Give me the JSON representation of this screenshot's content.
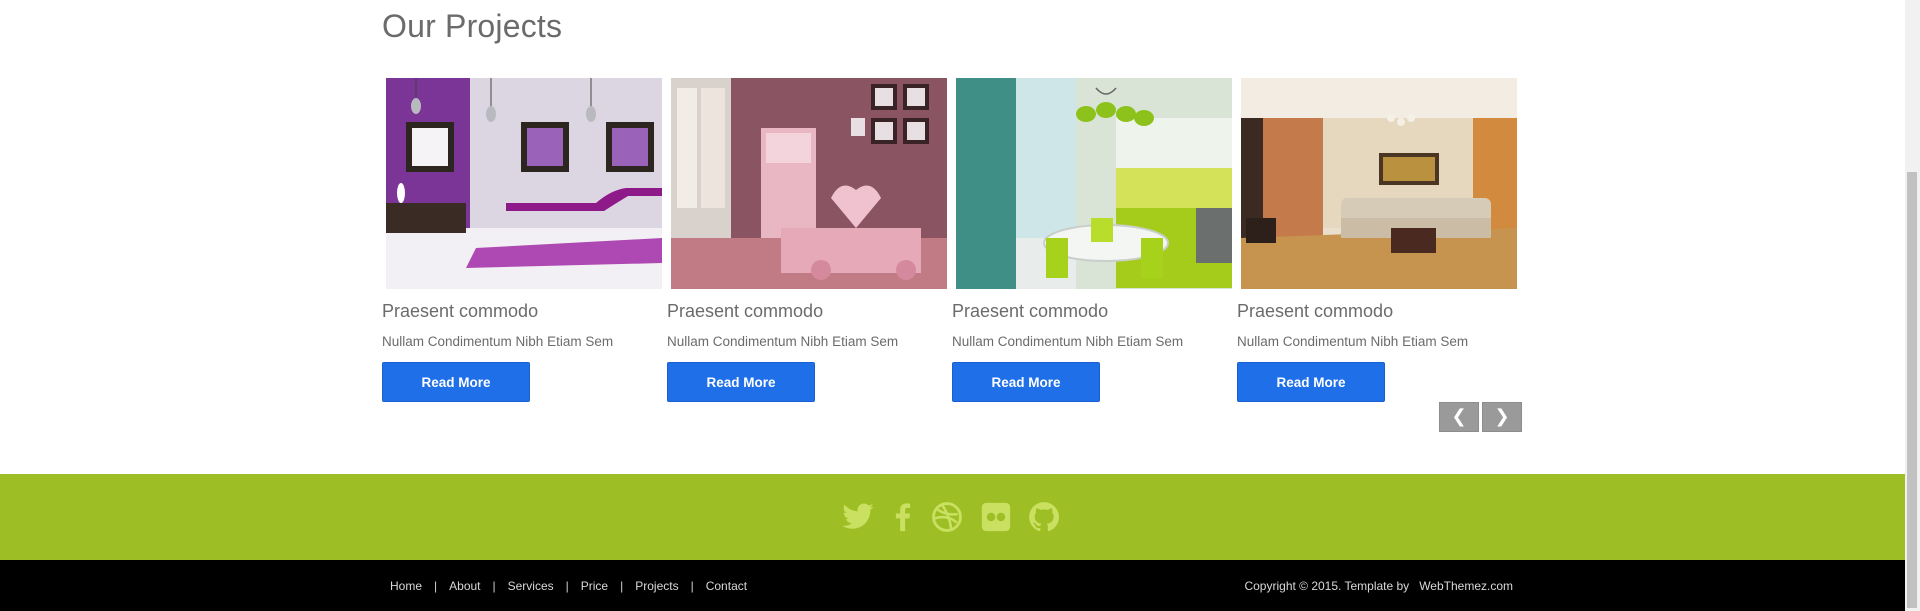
{
  "projects": {
    "title": "Our Projects",
    "items": [
      {
        "title": "Praesent commodo",
        "subtitle": "Nullam Condimentum Nibh Etiam Sem",
        "button": "Read More"
      },
      {
        "title": "Praesent commodo",
        "subtitle": "Nullam Condimentum Nibh Etiam Sem",
        "button": "Read More"
      },
      {
        "title": "Praesent commodo",
        "subtitle": "Nullam Condimentum Nibh Etiam Sem",
        "button": "Read More"
      },
      {
        "title": "Praesent commodo",
        "subtitle": "Nullam Condimentum Nibh Etiam Sem",
        "button": "Read More"
      }
    ],
    "prev_label": "❮",
    "next_label": "❯"
  },
  "social": {
    "icons": [
      "twitter-icon",
      "facebook-icon",
      "dribbble-icon",
      "flickr-icon",
      "github-icon"
    ],
    "color": "#c9e060"
  },
  "footer": {
    "nav": [
      "Home",
      "About",
      "Services",
      "Price",
      "Projects",
      "Contact"
    ],
    "separator": "|",
    "copyright": "Copyright © 2015. Template by",
    "credit": "WebThemez.com"
  },
  "colors": {
    "accent_green": "#9dbf25",
    "button_blue": "#1f6fe8",
    "footer_black": "#000000"
  }
}
